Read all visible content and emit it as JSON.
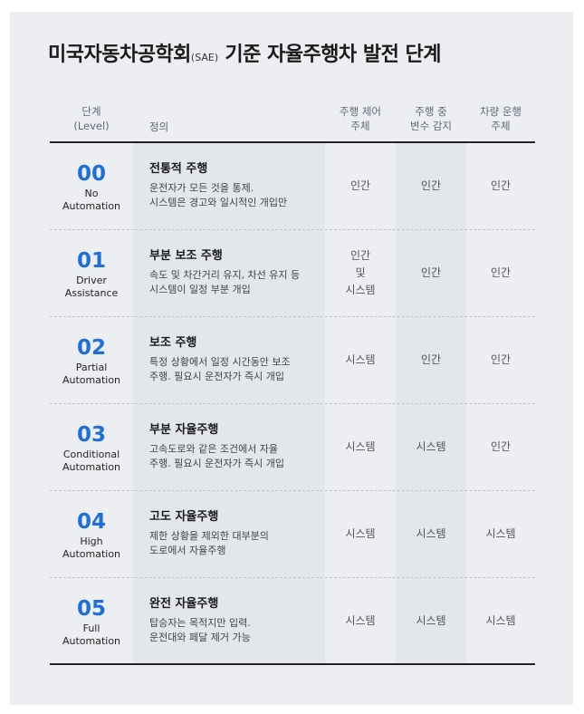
{
  "title": {
    "main": "미국자동차공학회",
    "sub": "(SAE)",
    "rest": " 기준 자율주행차 발전 단계"
  },
  "headers": {
    "level": "단계\n(Level)",
    "definition": "정의",
    "col1": "주행 제어\n주체",
    "col2": "주행 중\n변수 감지",
    "col3": "차량 운행\n주체"
  },
  "rows": [
    {
      "num": "00",
      "name": "No\nAutomation",
      "title": "전통적 주행",
      "desc": "운전자가 모든 것을 통제.\n시스템은 경고와 일시적인 개입만",
      "c1": "인간",
      "c2": "인간",
      "c3": "인간"
    },
    {
      "num": "01",
      "name": "Driver\nAssistance",
      "title": "부분 보조 주행",
      "desc": "속도 및 차간거리 유지, 차선 유지 등\n시스템이 일정 부분 개입",
      "c1": "인간\n및\n시스템",
      "c2": "인간",
      "c3": "인간"
    },
    {
      "num": "02",
      "name": "Partial\nAutomation",
      "title": "보조 주행",
      "desc": "특정 상황에서 일정 시간동안 보조\n주행. 필요시 운전자가 즉시 개입",
      "c1": "시스템",
      "c2": "인간",
      "c3": "인간"
    },
    {
      "num": "03",
      "name": "Conditional\nAutomation",
      "title": "부분 자율주행",
      "desc": "고속도로와 같은 조건에서 자율\n주행. 필요시 운전자가 즉시 개입",
      "c1": "시스템",
      "c2": "시스템",
      "c3": "인간"
    },
    {
      "num": "04",
      "name": "High\nAutomation",
      "title": "고도 자율주행",
      "desc": "제한 상황을 제외한 대부분의\n도로에서 자율주행",
      "c1": "시스템",
      "c2": "시스템",
      "c3": "시스템"
    },
    {
      "num": "05",
      "name": "Full\nAutomation",
      "title": "완전 자율주행",
      "desc": "탑승자는 목적지만 입력.\n운전대와 페달 제거 가능",
      "c1": "시스템",
      "c2": "시스템",
      "c3": "시스템"
    }
  ]
}
